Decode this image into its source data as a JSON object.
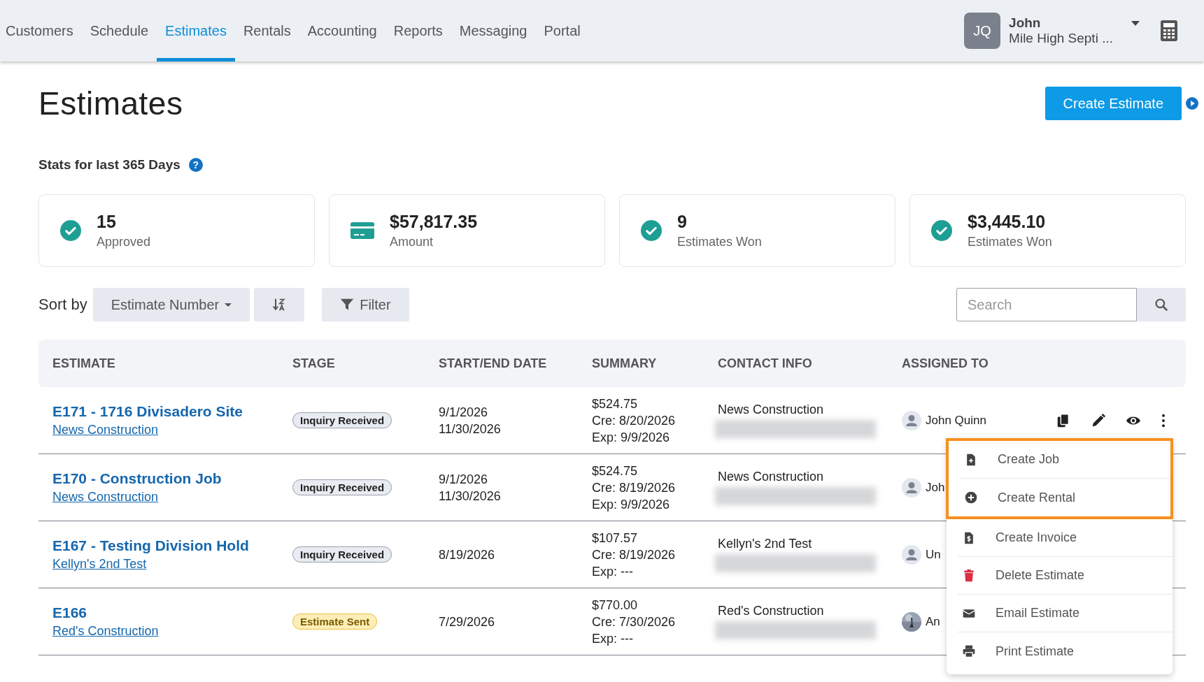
{
  "nav": {
    "items": [
      {
        "label": "Customers",
        "selected": false
      },
      {
        "label": "Schedule",
        "selected": false
      },
      {
        "label": "Estimates",
        "selected": true
      },
      {
        "label": "Rentals",
        "selected": false
      },
      {
        "label": "Accounting",
        "selected": false
      },
      {
        "label": "Reports",
        "selected": false
      },
      {
        "label": "Messaging",
        "selected": false
      },
      {
        "label": "Portal",
        "selected": false
      }
    ],
    "user": {
      "initials": "JQ",
      "name": "John",
      "company": "Mile High Septi ..."
    }
  },
  "title": "Estimates",
  "create_button": "Create Estimate",
  "stats_heading": "Stats for last 365 Days",
  "stats_help": "?",
  "stats": [
    {
      "kind": "check",
      "value": "15",
      "label": "Approved"
    },
    {
      "kind": "card",
      "value": "$57,817.35",
      "label": "Amount"
    },
    {
      "kind": "check",
      "value": "9",
      "label": "Estimates Won"
    },
    {
      "kind": "check",
      "value": "$3,445.10",
      "label": "Estimates Won"
    }
  ],
  "toolbar": {
    "sort_label": "Sort by",
    "sort_field": "Estimate Number",
    "filter": "Filter",
    "search": {
      "placeholder": "Search"
    }
  },
  "table": {
    "columns": [
      "ESTIMATE",
      "STAGE",
      "START/END DATE",
      "SUMMARY",
      "CONTACT INFO",
      "ASSIGNED TO"
    ],
    "rows": [
      {
        "title": "E171 - 1716 Divisadero Site",
        "customer": "News Construction",
        "stage": {
          "label": "Inquiry Received",
          "kind": "inquiry"
        },
        "dates": [
          "9/1/2026",
          "11/30/2026"
        ],
        "summary": [
          "$524.75",
          "Cre: 8/20/2026",
          "Exp: 9/9/2026"
        ],
        "contact": "News Construction",
        "contact_redacted": true,
        "assignee": {
          "name": "John Quinn",
          "kind": "person"
        },
        "actions": true
      },
      {
        "title": "E170 - Construction Job",
        "customer": "News Construction",
        "stage": {
          "label": "Inquiry Received",
          "kind": "inquiry"
        },
        "dates": [
          "9/1/2026",
          "11/30/2026"
        ],
        "summary": [
          "$524.75",
          "Cre: 8/19/2026",
          "Exp: 9/9/2026"
        ],
        "contact": "News Construction",
        "contact_redacted": true,
        "assignee": {
          "name": "Joh",
          "kind": "person"
        },
        "actions": false
      },
      {
        "title": "E167 - Testing Division Hold",
        "customer": "Kellyn's 2nd Test",
        "stage": {
          "label": "Inquiry Received",
          "kind": "inquiry"
        },
        "dates": [
          "8/19/2026"
        ],
        "summary": [
          "$107.57",
          "Cre: 8/19/2026",
          "Exp: ---"
        ],
        "contact": "Kellyn's 2nd Test",
        "contact_redacted": true,
        "assignee": {
          "name": "Un",
          "kind": "person"
        },
        "actions": false
      },
      {
        "title": "E166",
        "customer": "Red's Construction",
        "stage": {
          "label": "Estimate Sent",
          "kind": "sent"
        },
        "dates": [
          "7/29/2026"
        ],
        "summary": [
          "$770.00",
          "Cre: 7/30/2026",
          "Exp: ---"
        ],
        "contact": "Red's Construction",
        "contact_redacted": true,
        "assignee": {
          "name": "An",
          "kind": "picture"
        },
        "actions": false
      }
    ]
  },
  "menu": {
    "items": [
      {
        "label": "Create Job",
        "highlighted": true
      },
      {
        "label": "Create Rental",
        "highlighted": true
      },
      {
        "label": "Create Invoice",
        "highlighted": false
      },
      {
        "label": "Delete Estimate",
        "highlighted": false
      },
      {
        "label": "Email Estimate",
        "highlighted": false
      },
      {
        "label": "Print Estimate",
        "highlighted": false
      }
    ]
  }
}
